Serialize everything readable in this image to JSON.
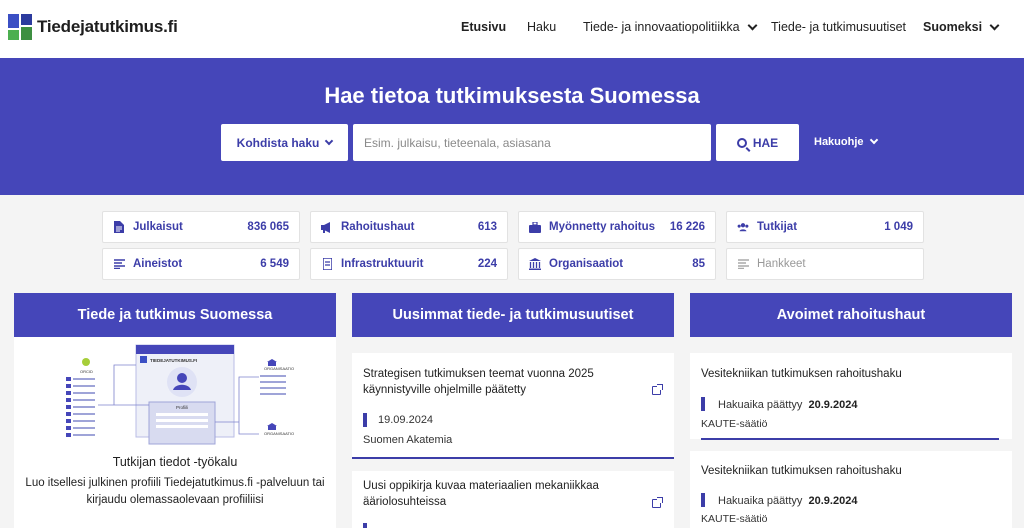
{
  "header": {
    "logo_text": "Tiedejatutkimus.fi",
    "nav": [
      {
        "label": "Etusivu",
        "active": true
      },
      {
        "label": "Haku"
      },
      {
        "label": "Tiede- ja innovaatiopolitiikka",
        "dropdown": true
      },
      {
        "label": "Tiede- ja tutkimusuutiset"
      }
    ],
    "language": "Suomeksi"
  },
  "hero": {
    "title": "Hae tietoa tutkimuksesta Suomessa",
    "target_label": "Kohdista haku",
    "search_placeholder": "Esim. julkaisu, tieteenala, asiasana",
    "search_value": "",
    "search_button": "HAE",
    "help_label": "Hakuohje"
  },
  "stats": [
    {
      "label": "Julkaisut",
      "count": "836 065",
      "icon": "document-icon"
    },
    {
      "label": "Rahoitushaut",
      "count": "613",
      "icon": "megaphone-icon"
    },
    {
      "label": "Myönnetty rahoitus",
      "count": "16 226",
      "icon": "briefcase-icon"
    },
    {
      "label": "Tutkijat",
      "count": "1 049",
      "icon": "users-icon"
    },
    {
      "label": "Aineistot",
      "count": "6 549",
      "icon": "list-icon"
    },
    {
      "label": "Infrastruktuurit",
      "count": "224",
      "icon": "server-icon"
    },
    {
      "label": "Organisaatiot",
      "count": "85",
      "icon": "building-icon"
    },
    {
      "label": "Hankkeet",
      "count": "",
      "icon": "list-icon",
      "disabled": true
    }
  ],
  "columns": {
    "left": {
      "title": "Tiede ja tutkimus Suomessa",
      "illustration_labels": {
        "site": "TIEDEJATUTKIMUS.FI",
        "orcid": "ORCID",
        "org1": "ORGANISAATIO",
        "org2": "ORGANISAATIO",
        "profile": "Profiili"
      },
      "tool_title": "Tutkijan tiedot -työkalu",
      "tool_desc": "Luo itsellesi julkinen profiili Tiedejatutkimus.fi -palveluun tai kirjaudu olemassaolevaan profiiliisi"
    },
    "middle": {
      "title": "Uusimmat tiede- ja tutkimusuutiset",
      "news": [
        {
          "title": "Strategisen tutkimuksen teemat vuonna 2025 käynnistyville ohjelmille päätetty",
          "date": "19.09.2024",
          "source": "Suomen Akatemia"
        },
        {
          "title": "Uusi oppikirja kuvaa materiaalien mekaniikkaa ääriolosuhteissa",
          "date": "",
          "source": ""
        }
      ]
    },
    "right": {
      "title": "Avoimet rahoitushaut",
      "calls": [
        {
          "title": "Vesitekniikan tutkimuksen rahoitushaku",
          "deadline_label": "Hakuaika päättyy",
          "deadline": "20.9.2024",
          "funder": "KAUTE-säätiö"
        },
        {
          "title": "Vesitekniikan tutkimuksen rahoitushaku",
          "deadline_label": "Hakuaika päättyy",
          "deadline": "20.9.2024",
          "funder": "KAUTE-säätiö"
        }
      ]
    }
  },
  "colors": {
    "primary": "#4546b9",
    "accent": "#3c3da8",
    "logo_blue": "#3b4fc4",
    "logo_green": "#4caf50"
  }
}
